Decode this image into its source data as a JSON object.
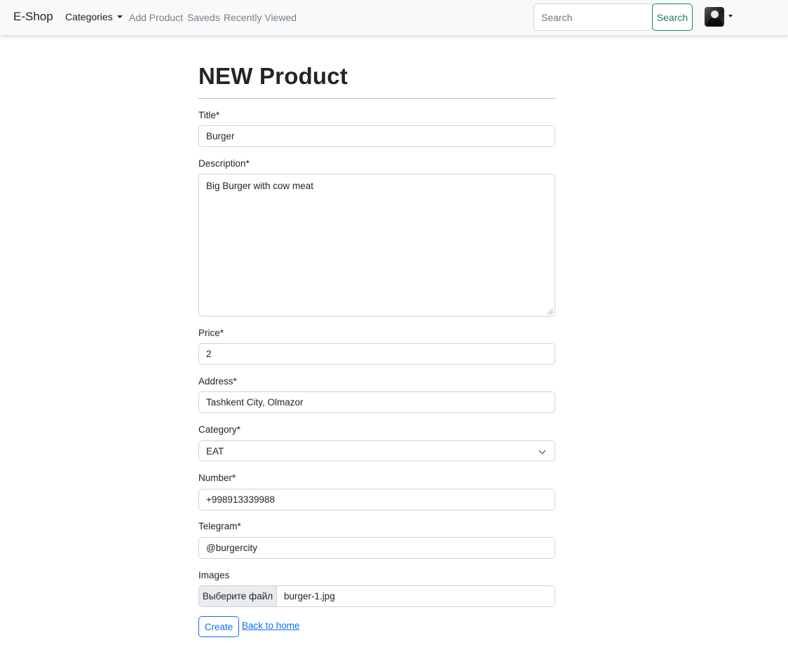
{
  "navbar": {
    "brand": "E-Shop",
    "categories_label": "Categories",
    "links": [
      "Add Product",
      "Saveds",
      "Recently Viewed"
    ],
    "search_placeholder": "Search",
    "search_button": "Search",
    "accent_color": "#198754"
  },
  "form": {
    "title": "NEW Product",
    "fields": {
      "title": {
        "label": "Title*",
        "value": "Burger"
      },
      "description": {
        "label": "Description*",
        "value": "Big Burger with cow meat"
      },
      "price": {
        "label": "Price*",
        "value": "2"
      },
      "address": {
        "label": "Address*",
        "value": "Tashkent City, Olmazor"
      },
      "category": {
        "label": "Category*",
        "value": "EAT"
      },
      "number": {
        "label": "Number*",
        "value": "+998913339988"
      },
      "telegram": {
        "label": "Telegram*",
        "value": "@burgercity"
      },
      "images": {
        "label": "Images",
        "button": "Выберите файл",
        "file": "burger-1.jpg"
      }
    },
    "create_button": "Create",
    "back_link": "Back to home",
    "primary_color": "#0d6efd"
  }
}
